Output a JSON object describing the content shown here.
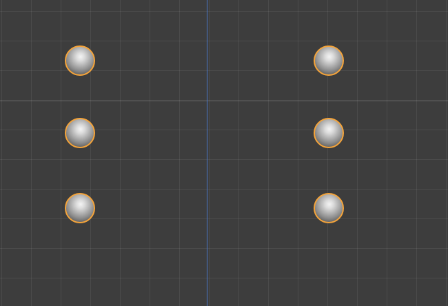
{
  "viewport": {
    "background_color": "#3d3d3d",
    "grid_line_color": "#4a4a4a",
    "y_axis_color": "#4a77c9",
    "selection_outline_color": "#f5a43a"
  },
  "objects": [
    {
      "name": "sphere",
      "selected": true
    },
    {
      "name": "sphere",
      "selected": true
    },
    {
      "name": "sphere",
      "selected": true
    },
    {
      "name": "sphere",
      "selected": true
    },
    {
      "name": "sphere",
      "selected": true
    },
    {
      "name": "sphere",
      "selected": true
    }
  ]
}
